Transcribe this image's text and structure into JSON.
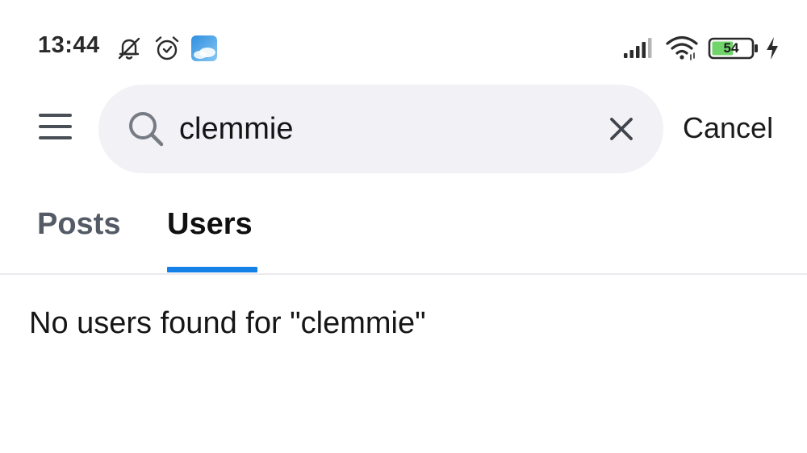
{
  "status_bar": {
    "time": "13:44",
    "battery_level": "54",
    "icons": [
      "notifications-muted-icon",
      "alarm-icon",
      "weather-app-icon",
      "signal-icon",
      "wifi-icon",
      "battery-icon",
      "charging-icon"
    ]
  },
  "search": {
    "query": "clemmie",
    "cancel_label": "Cancel"
  },
  "tabs": [
    {
      "label": "Posts",
      "active": false
    },
    {
      "label": "Users",
      "active": true
    }
  ],
  "results": {
    "empty_message": "No users found for \"clemmie\""
  },
  "colors": {
    "accent": "#1580e5",
    "search_background": "#f1f1f6",
    "inactive_tab": "#555b66",
    "battery_fill": "#6fd46a"
  }
}
